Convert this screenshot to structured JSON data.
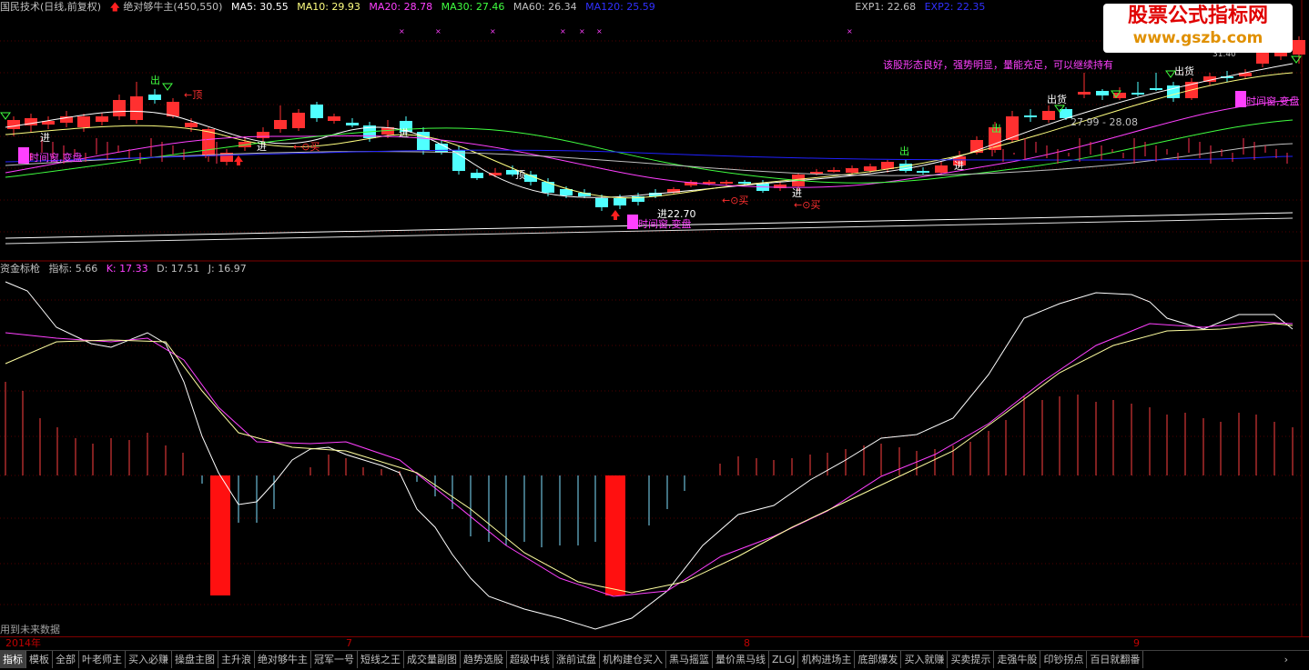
{
  "header": {
    "title": "国民技术(日线,前复权)",
    "formula": "绝对够牛主(450,550)",
    "ma5": "MA5: 30.55",
    "ma10": "MA10: 29.93",
    "ma20": "MA20: 28.78",
    "ma30": "MA30: 27.46",
    "ma60": "MA60: 26.34",
    "ma120": "MA120: 25.59",
    "exp1": "EXP1: 22.68",
    "exp2": "EXP2: 22.35"
  },
  "watermark": {
    "line1": "股票公式指标网",
    "line2": "www.gszb.com"
  },
  "annotations": {
    "comment": "该股形态良好，强势明显，量能充足，可以继续持有",
    "price_range": "27.99 - 28.08",
    "low_price": "22.70",
    "top_label": "←顶",
    "chu": "出",
    "chu_huo": "出货",
    "jin": "进",
    "buy": "←⊙买",
    "time_window": "时间窗,变盘",
    "dian": "顶",
    "top_right_partial": "31.40"
  },
  "indicator": {
    "name": "资金标枪",
    "label": "指标: 5.66",
    "k": "K: 17.33",
    "d": "D: 17.51",
    "j": "J: 16.97"
  },
  "future_note": "用到未来数据",
  "axis": {
    "year": "2014年",
    "m7": "7",
    "m8": "8",
    "m9": "9"
  },
  "tabs": [
    "指标",
    "模板",
    "全部",
    "叶老师主",
    "买入必赚",
    "操盘主图",
    "主升浪",
    "绝对够牛主",
    "冠军一号",
    "短线之王",
    "成交量副图",
    "趋势选股",
    "超级中线",
    "涨前试盘",
    "机构建仓买入",
    "黑马摇篮",
    "量价黑马线",
    "ZLGJ",
    "机构进场主",
    "底部爆发",
    "买入就赚",
    "买卖提示",
    "走强牛股",
    "印钞拐点",
    "百日就翻番"
  ],
  "tab_more": "›",
  "colors": {
    "up": "#ff3030",
    "down": "#50ffff",
    "ma5": "#ffffff",
    "ma10": "#ffff80",
    "ma20": "#ff40ff",
    "ma30": "#40ff40",
    "ma60": "#c0c0c0",
    "ma120": "#2020ff",
    "k": "#ffffff",
    "d": "#ff40ff",
    "j": "#ffffa0"
  }
}
